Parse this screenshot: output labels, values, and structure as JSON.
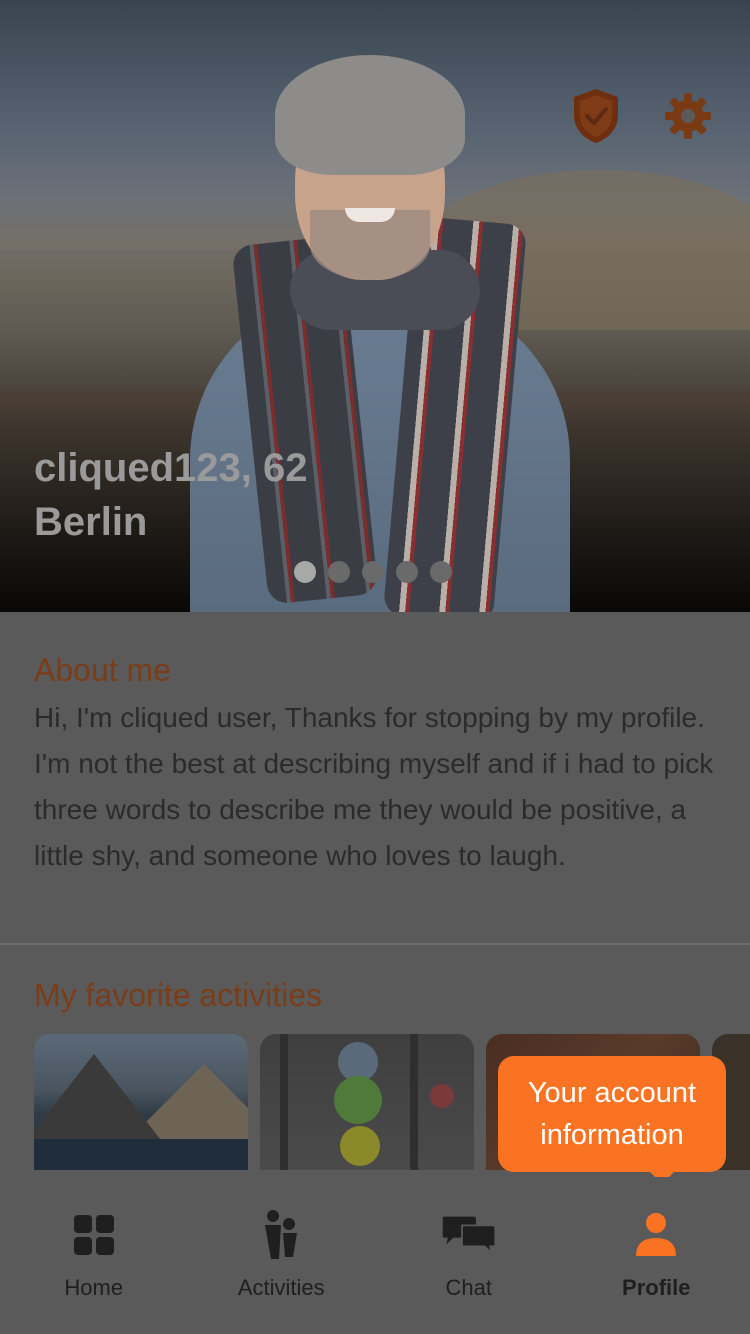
{
  "profile": {
    "name_age": "cliqued123, 62",
    "city": "Berlin",
    "photo_count": 5,
    "active_photo_index": 0
  },
  "about": {
    "title": "About me",
    "text": "Hi, I'm cliqued user, Thanks for stopping by my profile. I'm not the best at describing myself and if i had to pick three words to describe me they would be positive, a little shy, and someone who loves to laugh."
  },
  "activities": {
    "title": "My favorite activities"
  },
  "tooltip": {
    "text": "Your account information"
  },
  "tabs": [
    {
      "label": "Home",
      "icon": "grid-icon"
    },
    {
      "label": "Activities",
      "icon": "people-icon"
    },
    {
      "label": "Chat",
      "icon": "chat-icon"
    },
    {
      "label": "Profile",
      "icon": "person-icon",
      "active": true
    }
  ],
  "colors": {
    "accent": "#f97322",
    "accent_dim": "#7a3d18",
    "overlay_bg": "#5a5a5a"
  }
}
